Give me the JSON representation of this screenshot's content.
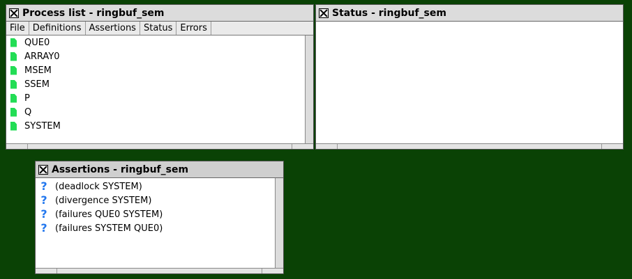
{
  "process_window": {
    "title": "Process list - ringbuf_sem",
    "menu": [
      "File",
      "Definitions",
      "Assertions",
      "Status",
      "Errors"
    ],
    "processes": [
      "QUE0",
      "ARRAY0",
      "MSEM",
      "SSEM",
      "P",
      "Q",
      "SYSTEM"
    ],
    "icon": "process-file-icon"
  },
  "status_window": {
    "title": "Status - ringbuf_sem"
  },
  "assertions_window": {
    "title": "Assertions - ringbuf_sem",
    "assertions": [
      "(deadlock SYSTEM)",
      "(divergence SYSTEM)",
      "(failures QUE0 SYSTEM)",
      "(failures SYSTEM QUE0)"
    ],
    "icon_glyph": "?",
    "icon_color": "#2277ee"
  },
  "colors": {
    "desktop": "#0a4205",
    "process_icon": "#22dd55"
  }
}
